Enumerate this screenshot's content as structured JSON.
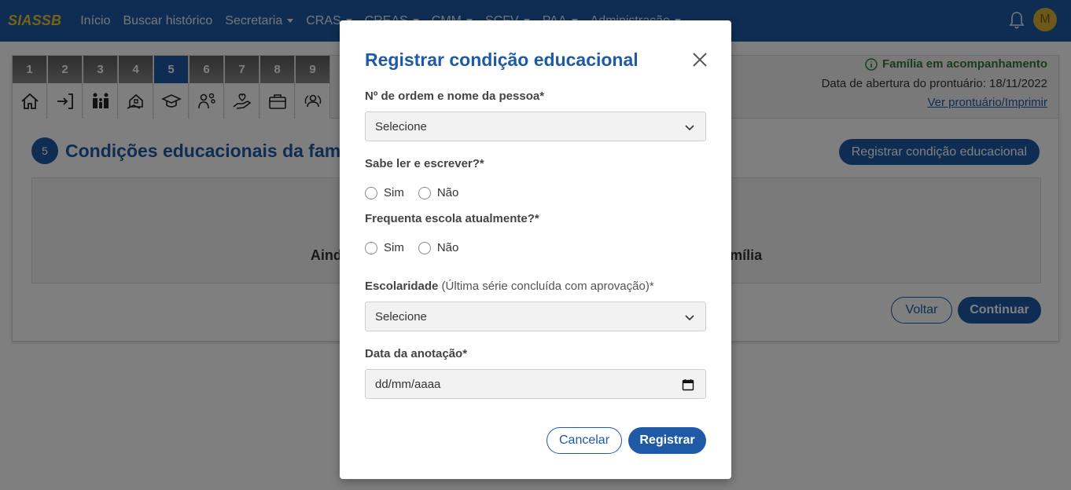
{
  "navbar": {
    "brand": "SIASSB",
    "items": [
      {
        "label": "Início",
        "dropdown": false
      },
      {
        "label": "Buscar histórico",
        "dropdown": false
      },
      {
        "label": "Secretaria",
        "dropdown": true
      },
      {
        "label": "CRAS",
        "dropdown": true
      },
      {
        "label": "CREAS",
        "dropdown": true
      },
      {
        "label": "CMM",
        "dropdown": true
      },
      {
        "label": "SCFV",
        "dropdown": true
      },
      {
        "label": "PAA",
        "dropdown": true
      },
      {
        "label": "Administração",
        "dropdown": true
      }
    ],
    "avatar_initial": "M"
  },
  "steps": [
    "1",
    "2",
    "3",
    "4",
    "5",
    "6",
    "7",
    "8",
    "9"
  ],
  "active_step": "5",
  "status": {
    "family_status": "Família em acompanhamento",
    "open_date": "Data de abertura do prontuário: 18/11/2022",
    "view_link": "Ver prontuário/Imprimir"
  },
  "section": {
    "badge": "5",
    "title": "Condições educacionais da família",
    "register_button": "Registrar condição educacional",
    "empty_message": "Ainda não há condições educacionais registradas para esta família",
    "back_button": "Voltar",
    "continue_button": "Continuar"
  },
  "modal": {
    "title": "Registrar condição educacional",
    "person_label": "Nº de ordem e nome da pessoa*",
    "person_value": "Selecione",
    "literacy_label": "Sabe ler e escrever?*",
    "school_label": "Frequenta escola atualmente?*",
    "yes": "Sim",
    "no": "Não",
    "education_label": "Escolaridade",
    "education_hint": " (Última série concluída com aprovação)*",
    "education_value": "Selecione",
    "date_label": "Data da anotação*",
    "date_placeholder": "dd/mm/aaaa",
    "cancel_button": "Cancelar",
    "submit_button": "Registrar"
  },
  "colors": {
    "primary": "#1e5aa6",
    "brand": "#f2c230",
    "success": "#2e7d32"
  }
}
